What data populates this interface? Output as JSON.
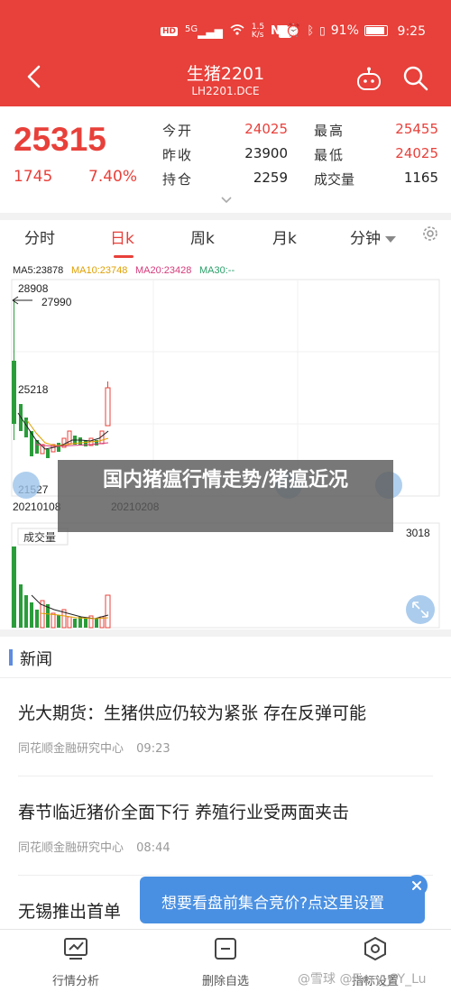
{
  "status_bar": {
    "network": "HD",
    "signal": "5G",
    "speed": "1.5 K/s",
    "battery": "91%",
    "time": "9:25"
  },
  "header": {
    "title": "生猪2201",
    "subtitle": "LH2201.DCE",
    "back_icon": "chevron-left-icon",
    "robot_icon": "robot-icon",
    "search_icon": "search-icon",
    "colors": {
      "background": "#e8403a"
    }
  },
  "quote": {
    "price": "25315",
    "change": "1745",
    "change_pct": "7.40%",
    "stats": [
      {
        "label": "今开",
        "value": "24025",
        "color": "red"
      },
      {
        "label": "最高",
        "value": "25455",
        "color": "red"
      },
      {
        "label": "昨收",
        "value": "23900",
        "color": "dark"
      },
      {
        "label": "最低",
        "value": "24025",
        "color": "red"
      },
      {
        "label": "持仓",
        "value": "2259",
        "color": "dark"
      },
      {
        "label": "成交量",
        "value": "1165",
        "color": "dark"
      }
    ]
  },
  "tabs": [
    {
      "label": "分时",
      "active": false
    },
    {
      "label": "日k",
      "active": true
    },
    {
      "label": "周k",
      "active": false
    },
    {
      "label": "月k",
      "active": false
    },
    {
      "label": "分钟",
      "active": false
    }
  ],
  "chart": {
    "ma": [
      {
        "label": "MA5:23878",
        "color": "#222222"
      },
      {
        "label": "MA10:23748",
        "color": "#e0a000"
      },
      {
        "label": "MA20:23428",
        "color": "#d63a7a"
      },
      {
        "label": "MA30:--",
        "color": "#2aa06a"
      }
    ],
    "high_label": "28908",
    "arrow_high": "27990",
    "mid_label": "25218",
    "low_label": "21527",
    "date_left": "20210108",
    "date_right": "20210208",
    "volume_label": "成交量",
    "volume_max": "3018"
  },
  "overlay_caption": "国内猪瘟行情走势/猪瘟近况",
  "news": {
    "title": "新闻",
    "items": [
      {
        "headline": "光大期货：生猪供应仍较为紧张  存在反弹可能",
        "source": "同花顺金融研究中心",
        "time": "09:23"
      },
      {
        "headline": "春节临近猪价全面下行 养殖行业受两面夹击",
        "source": "同花顺金融研究中心",
        "time": "08:44"
      },
      {
        "headline": "无锡推出首单",
        "source": "",
        "time": ""
      }
    ]
  },
  "tooltip": {
    "text": "想要看盘前集合竞价?点这里设置",
    "close_icon": "close-icon"
  },
  "bottom_bar": [
    {
      "label": "行情分析",
      "icon": "chart-analysis-icon"
    },
    {
      "label": "删除自选",
      "icon": "minus-square-icon"
    },
    {
      "label": "指标设置",
      "icon": "settings-hexagon-icon"
    }
  ],
  "watermark": "@雪球 @Fiery_CY_Lu"
}
